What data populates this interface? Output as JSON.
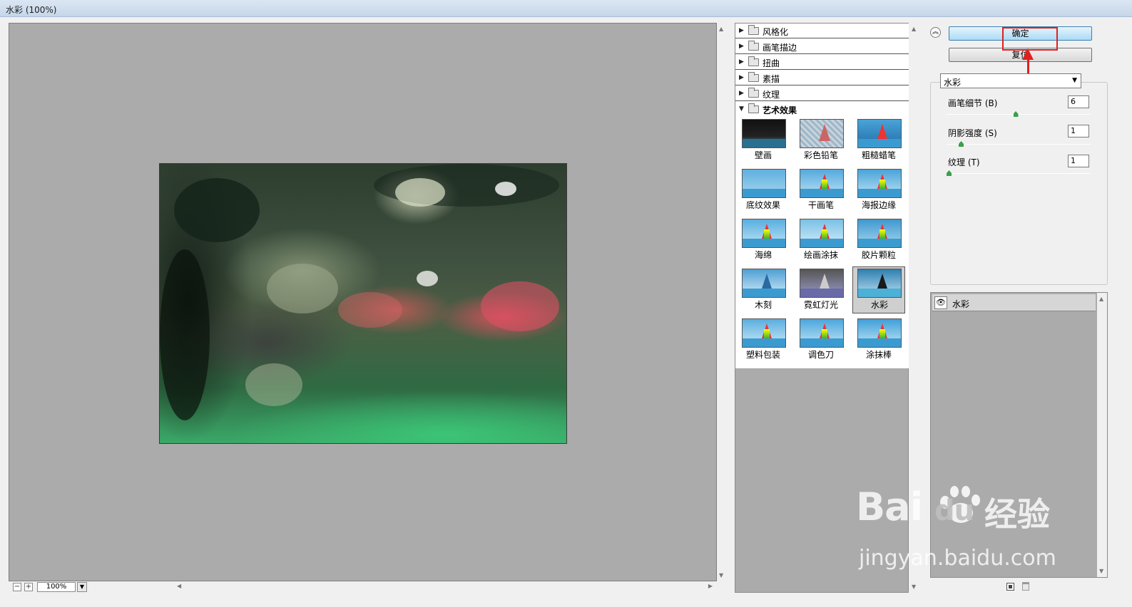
{
  "window": {
    "title": "水彩 (100%)"
  },
  "preview": {
    "zoom": "100%"
  },
  "gallery": {
    "categories": [
      {
        "label": "风格化",
        "expanded": false
      },
      {
        "label": "画笔描边",
        "expanded": false
      },
      {
        "label": "扭曲",
        "expanded": false
      },
      {
        "label": "素描",
        "expanded": false
      },
      {
        "label": "纹理",
        "expanded": false
      },
      {
        "label": "艺术效果",
        "expanded": true
      }
    ],
    "filters": [
      {
        "label": "壁画"
      },
      {
        "label": "彩色铅笔"
      },
      {
        "label": "粗糙蜡笔"
      },
      {
        "label": "底纹效果"
      },
      {
        "label": "干画笔"
      },
      {
        "label": "海报边缘"
      },
      {
        "label": "海绵"
      },
      {
        "label": "绘画涂抹"
      },
      {
        "label": "胶片颗粒"
      },
      {
        "label": "木刻"
      },
      {
        "label": "霓虹灯光"
      },
      {
        "label": "水彩"
      },
      {
        "label": "塑料包装"
      },
      {
        "label": "调色刀"
      },
      {
        "label": "涂抹棒"
      }
    ],
    "selected_filter": "水彩"
  },
  "controls": {
    "ok_label": "确定",
    "reset_label": "复位",
    "filter_select": "水彩",
    "params": [
      {
        "label": "画笔细节 (B)",
        "value": "6",
        "level": 0.55
      },
      {
        "label": "阴影强度 (S)",
        "value": "1",
        "level": 0.1
      },
      {
        "label": "纹理 (T)",
        "value": "1",
        "level": 0.0
      }
    ]
  },
  "layers": {
    "items": [
      {
        "name": "水彩"
      }
    ]
  },
  "watermark": {
    "logo": "Bai",
    "logo_du": "du",
    "cn": "经验",
    "url": "jingyan.baidu.com"
  },
  "colors": {
    "accent": "#3c7fb1",
    "annotation": "#e02020",
    "panel": "#ababab"
  }
}
